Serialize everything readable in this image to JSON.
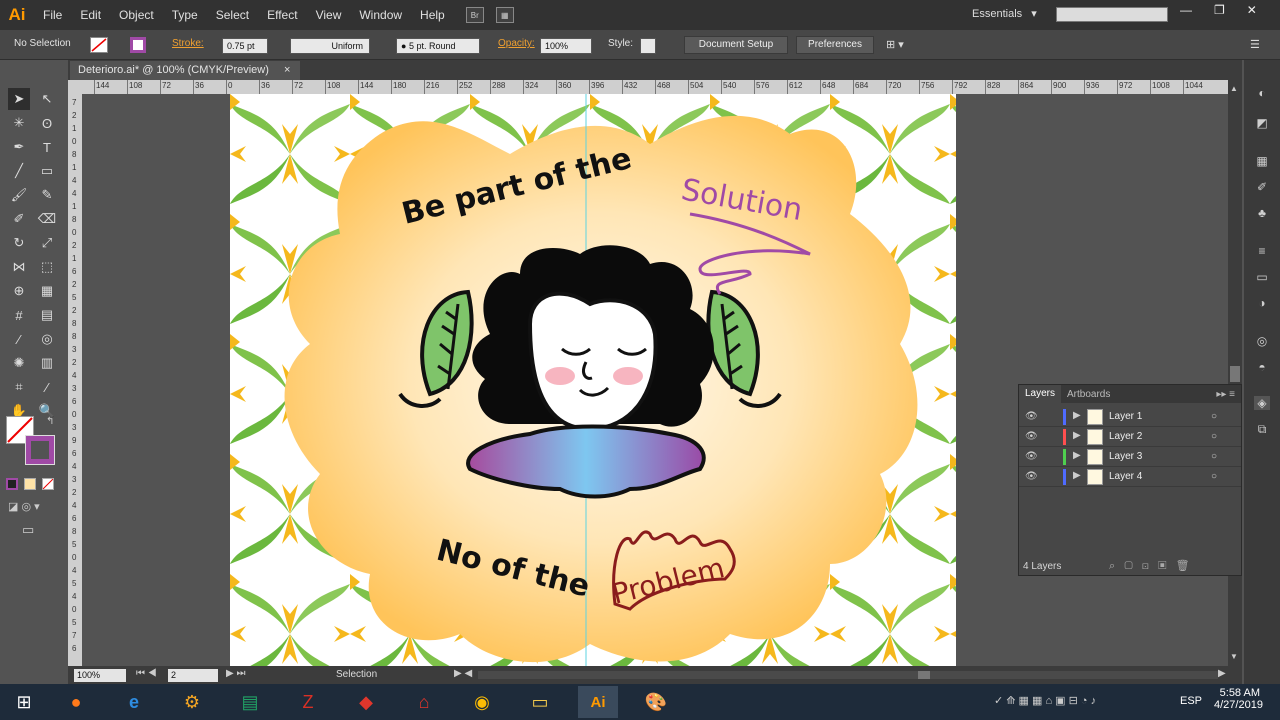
{
  "app": {
    "logo": "Ai"
  },
  "menu": [
    "File",
    "Edit",
    "Object",
    "Type",
    "Select",
    "Effect",
    "View",
    "Window",
    "Help"
  ],
  "topbar": {
    "workspace": "Essentials",
    "workspace_arrow": "▾",
    "search_placeholder": ""
  },
  "window_controls": {
    "minimize": "—",
    "restore": "❐",
    "close": "✕"
  },
  "control_bar": {
    "selection": "No Selection",
    "stroke_label": "Stroke:",
    "stroke_weight": "0.75 pt",
    "profile": "Uniform",
    "brush": "5 pt. Round",
    "opacity_label": "Opacity:",
    "opacity": "100%",
    "style_label": "Style:",
    "document_setup": "Document Setup",
    "preferences": "Preferences"
  },
  "document": {
    "tab_title": "Deterioro.ai* @ 100% (CMYK/Preview)",
    "close": "×"
  },
  "ruler": {
    "h_ticks": [
      "144",
      "108",
      "72",
      "36",
      "0",
      "36",
      "72",
      "108",
      "144",
      "180",
      "216",
      "252",
      "288",
      "324",
      "360",
      "396",
      "432",
      "468",
      "504",
      "540",
      "576",
      "612",
      "648",
      "684",
      "720",
      "756",
      "792",
      "828",
      "864",
      "900",
      "936",
      "972",
      "1008",
      "1044"
    ],
    "v_ticks": [
      "7",
      "2",
      "1",
      "0",
      "8",
      "1",
      "4",
      "4",
      "1",
      "8",
      "0",
      "2",
      "1",
      "6",
      "2",
      "5",
      "2",
      "8",
      "8",
      "3",
      "2",
      "4",
      "3",
      "6",
      "0",
      "3",
      "9",
      "6",
      "4",
      "3",
      "2",
      "4",
      "6",
      "8",
      "5",
      "0",
      "4",
      "5",
      "4",
      "0",
      "5",
      "7",
      "6"
    ]
  },
  "artwork": {
    "headline": "Be part of the",
    "headline_accent": "Solution",
    "footer": "No of the",
    "footer_accent": "Problem"
  },
  "status": {
    "zoom": "100%",
    "artboard": "2",
    "tool": "Selection"
  },
  "layers_panel": {
    "tabs": [
      "Layers",
      "Artboards"
    ],
    "rows": [
      {
        "name": "Layer 1",
        "color": "#4f6bff"
      },
      {
        "name": "Layer 2",
        "color": "#ff4f4f"
      },
      {
        "name": "Layer 3",
        "color": "#4fcf4f"
      },
      {
        "name": "Layer 4",
        "color": "#4f6bff"
      }
    ],
    "footer": "4 Layers"
  },
  "taskbar": {
    "language": "ESP",
    "time": "5:58 AM",
    "date": "4/27/2019"
  },
  "colors": {
    "accent": "#ff9a00",
    "solution": "#a04aa6",
    "problem": "#8a1c1c",
    "glow": "#ffc45a"
  }
}
